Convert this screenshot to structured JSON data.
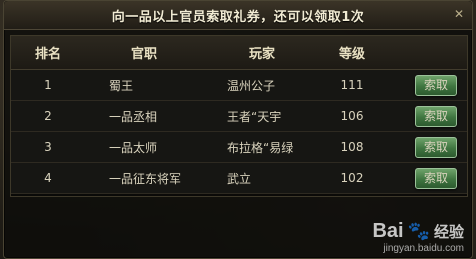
{
  "dialog": {
    "title": "向一品以上官员索取礼券，还可以领取1次",
    "close_glyph": "✕"
  },
  "table": {
    "headers": [
      "排名",
      "官职",
      "玩家",
      "等级"
    ],
    "rows": [
      {
        "rank": "1",
        "title": "蜀王",
        "player": "温州公子",
        "level": "111",
        "action": "索取"
      },
      {
        "rank": "2",
        "title": "一品丞相",
        "player": "王者“天宇",
        "level": "106",
        "action": "索取"
      },
      {
        "rank": "3",
        "title": "一品太师",
        "player": "布拉格“易绿",
        "level": "108",
        "action": "索取"
      },
      {
        "rank": "4",
        "title": "一品征东将军",
        "player": "武立",
        "level": "102",
        "action": "索取"
      }
    ]
  },
  "watermark": {
    "logo": "Bai",
    "paw": "🐾",
    "jingyan": "经验",
    "url": "jingyan.baidu.com"
  },
  "colors": {
    "accent_button": "#3f7540",
    "panel_bg": "#0c0c0a",
    "text": "#d9d3bd"
  }
}
